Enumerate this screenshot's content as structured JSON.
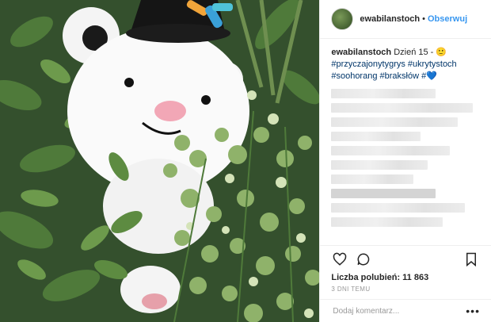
{
  "post": {
    "username": "ewabilanstoch",
    "separator": "•",
    "follow_label": "Obserwuj",
    "caption_text": "Dzień 15 - 🙂",
    "hashtags_line1": "#przyczajonytygrys #ukrytystoch",
    "hashtags_line2": "#soohorang #braksłów #💙",
    "likes_label": "Liczba polubień: 11 863",
    "time_ago": "3 DNI TEMU",
    "comment_placeholder": "Dodaj komentarz...",
    "more_glyph": "•••"
  },
  "icons": [
    "heart-icon",
    "comment-icon",
    "bookmark-icon",
    "more-options-icon"
  ],
  "colors": {
    "link": "#3897f0",
    "text": "#262626",
    "meta": "#999999",
    "border": "#efefef"
  }
}
